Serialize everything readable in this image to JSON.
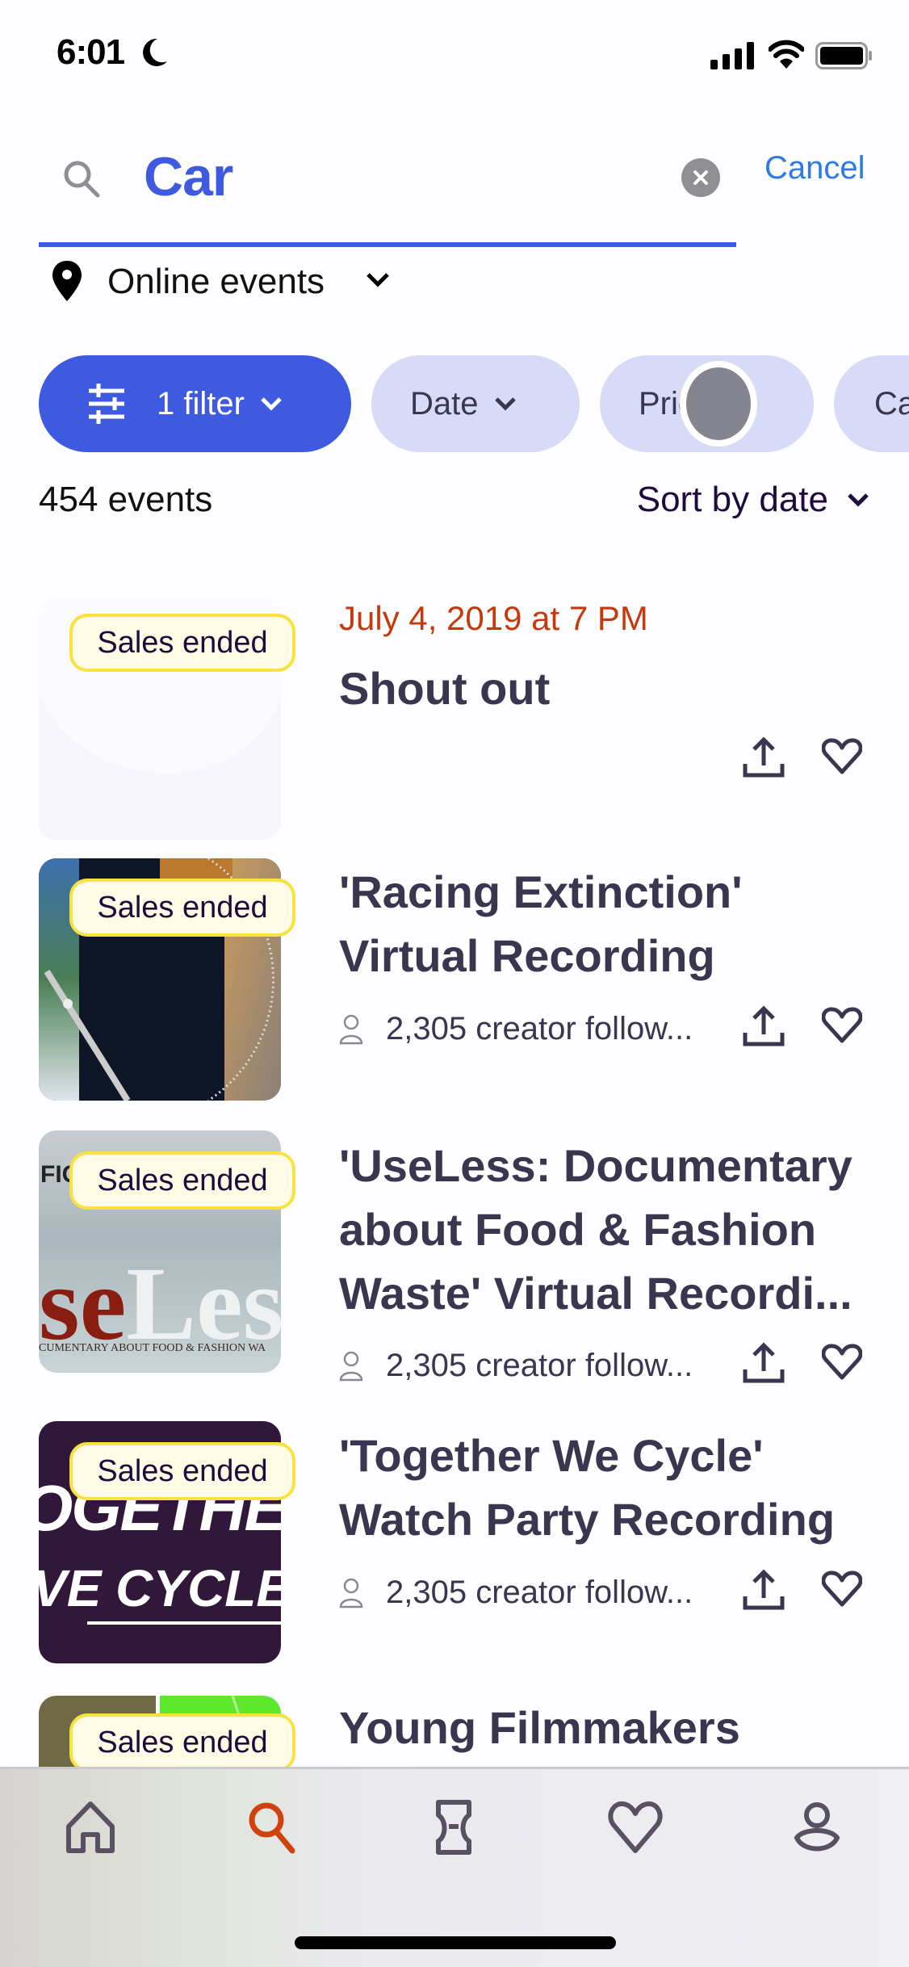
{
  "status_bar": {
    "time": "6:01",
    "icons": [
      "moon-icon",
      "signal-icon",
      "wifi-icon",
      "battery-icon"
    ]
  },
  "search": {
    "query": "Car",
    "cancel_label": "Cancel",
    "icon": "search-icon",
    "clear_icon": "clear-icon",
    "accent": "#3d5ae0"
  },
  "location": {
    "label": "Online events",
    "icon": "map-pin-icon"
  },
  "filters": {
    "chips": [
      {
        "label": "1 filter",
        "active": true,
        "icon": "sliders-icon"
      },
      {
        "label": "Date",
        "active": false
      },
      {
        "label": "Price",
        "active": false
      },
      {
        "label": "Ca",
        "active": false
      }
    ]
  },
  "results": {
    "count_label": "454 events",
    "sort_label": "Sort by date"
  },
  "events": [
    {
      "badge": "Sales ended",
      "date": "July 4, 2019 at 7 PM",
      "title_lines": [
        "Shout out"
      ],
      "followers": null
    },
    {
      "badge": "Sales ended",
      "date": null,
      "title_lines": [
        "'Racing Extinction'",
        "Virtual Recording"
      ],
      "followers": "2,305 creator follow..."
    },
    {
      "badge": "Sales ended",
      "date": null,
      "title_lines": [
        "'UseLess: Documentary",
        "about Food & Fashion",
        "Waste' Virtual Recordi..."
      ],
      "followers": "2,305 creator follow...",
      "thumb_text": {
        "big_red": "se",
        "big_white": "Les",
        "caption": "CUMENTARY ABOUT FOOD & FASHION WA",
        "logo": "FICM"
      }
    },
    {
      "badge": "Sales ended",
      "date": null,
      "title_lines": [
        "'Together We Cycle'",
        "Watch Party Recording"
      ],
      "followers": "2,305 creator follow...",
      "thumb_text": {
        "line1": "OGETHER",
        "line2": "VE CYCLE"
      }
    },
    {
      "badge": "Sales ended",
      "date": null,
      "title_lines": [
        "Young Filmmakers"
      ],
      "followers": null
    }
  ],
  "tab_bar": {
    "tabs": [
      {
        "name": "home",
        "icon": "home-icon",
        "active": false
      },
      {
        "name": "search",
        "icon": "search-icon",
        "active": true
      },
      {
        "name": "tickets",
        "icon": "ticket-icon",
        "active": false
      },
      {
        "name": "likes",
        "icon": "heart-icon",
        "active": false
      },
      {
        "name": "profile",
        "icon": "profile-icon",
        "active": false
      }
    ],
    "active_color": "#d1410c",
    "inactive_color": "#585163"
  },
  "colors": {
    "date_red": "#c7390b",
    "badge_bg": "#fffbe4",
    "badge_border": "#f8e23f",
    "chip_bg": "#d8dbf8",
    "text_dark": "#39364f"
  }
}
